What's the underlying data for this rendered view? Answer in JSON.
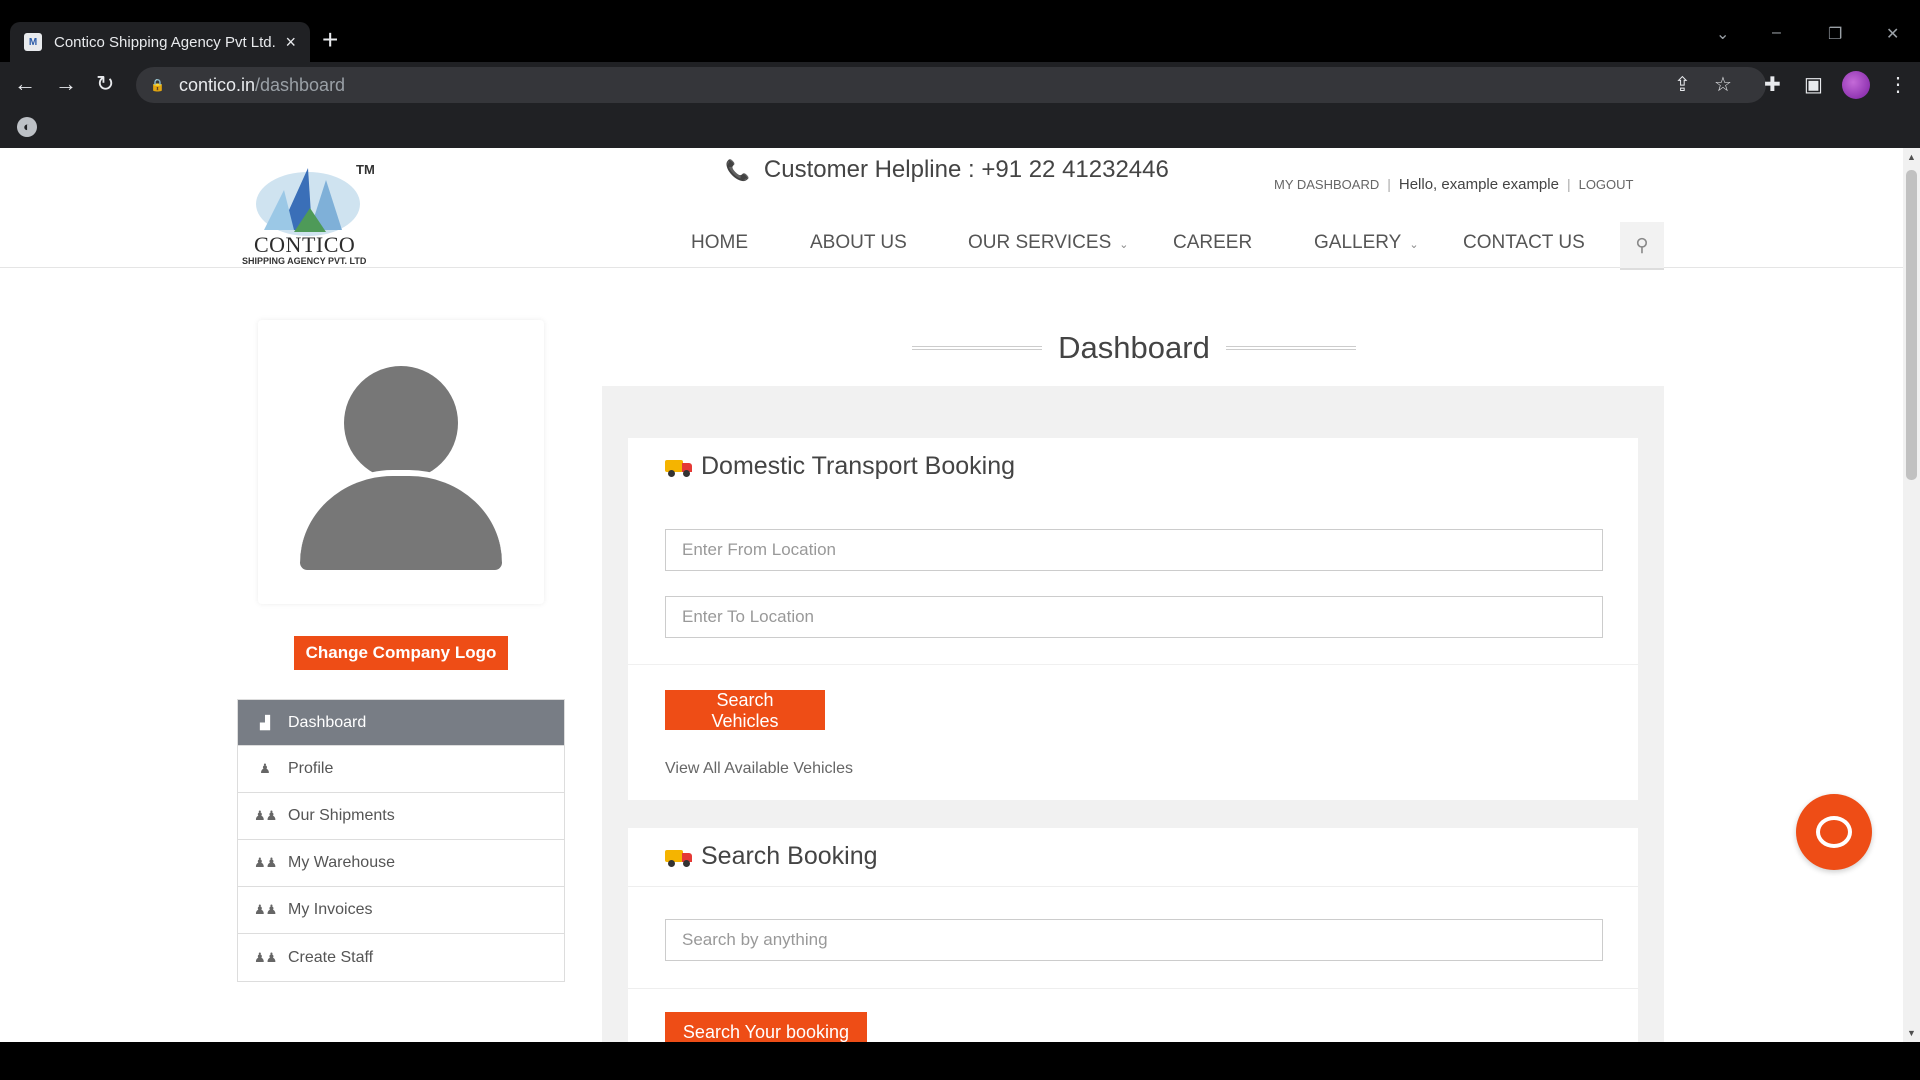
{
  "browser": {
    "tab_title": "Contico Shipping Agency Pvt Ltd.",
    "favicon_letter": "M",
    "url_host": "contico.in",
    "url_path": "/dashboard"
  },
  "header": {
    "logo": {
      "tm": "TM",
      "name": "CONTICO",
      "sub": "SHIPPING AGENCY PVT. LTD"
    },
    "helpline": "Customer Helpline : +91 22 41232446",
    "my_dashboard": "MY DASHBOARD",
    "hello": "Hello, example example",
    "logout": "LOGOUT",
    "nav": {
      "home": "HOME",
      "about": "ABOUT US",
      "services": "OUR SERVICES",
      "career": "CAREER",
      "gallery": "GALLERY",
      "contact": "CONTACT US"
    }
  },
  "sidebar": {
    "change_logo": "Change Company Logo",
    "items": [
      {
        "label": "Dashboard",
        "icon": "bar-chart-icon",
        "active": true
      },
      {
        "label": "Profile",
        "icon": "user-icon"
      },
      {
        "label": "Our Shipments",
        "icon": "users-icon"
      },
      {
        "label": "My Warehouse",
        "icon": "users-icon"
      },
      {
        "label": "My Invoices",
        "icon": "users-icon"
      },
      {
        "label": "Create Staff",
        "icon": "users-icon"
      }
    ]
  },
  "main": {
    "title": "Dashboard",
    "domestic": {
      "title": "Domestic Transport Booking",
      "from_placeholder": "Enter From Location",
      "to_placeholder": "Enter To Location",
      "search_btn": "Search Vehicles",
      "view_all": "View All Available Vehicles"
    },
    "search_booking": {
      "title": "Search Booking",
      "placeholder": "Search by anything",
      "btn": "Search Your booking"
    }
  },
  "colors": {
    "accent": "#ee4d16",
    "active_menu": "#787d85"
  }
}
